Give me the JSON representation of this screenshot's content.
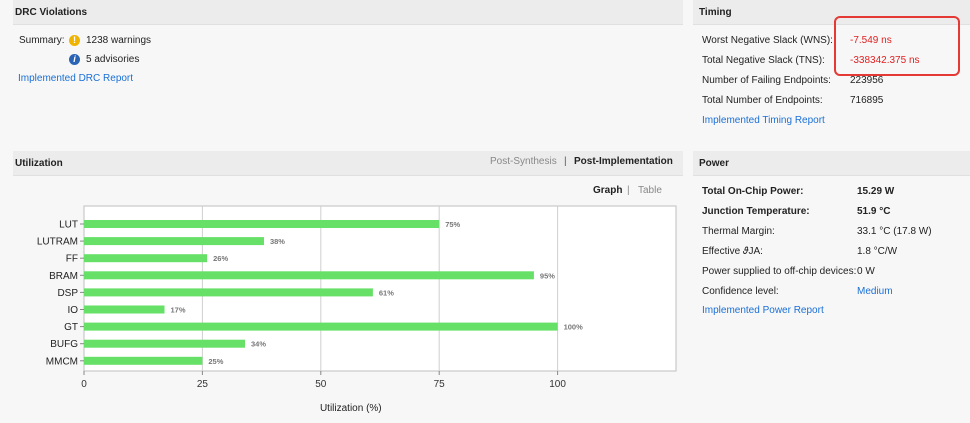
{
  "drc": {
    "title": "DRC Violations",
    "summary_label": "Summary:",
    "warnings_text": "1238 warnings",
    "advisories_text": "5 advisories",
    "report_link": "Implemented DRC Report"
  },
  "timing": {
    "title": "Timing",
    "rows": [
      {
        "label": "Worst Negative Slack (WNS):",
        "value": "-7.549 ns"
      },
      {
        "label": "Total Negative Slack (TNS):",
        "value": "-338342.375 ns"
      },
      {
        "label": "Number of Failing Endpoints:",
        "value": "223956"
      },
      {
        "label": "Total Number of Endpoints:",
        "value": "716895"
      }
    ],
    "report_link": "Implemented Timing Report"
  },
  "utilization": {
    "title": "Utilization",
    "tab_post_synthesis": "Post-Synthesis",
    "tab_separator": "|",
    "tab_post_implementation": "Post-Implementation",
    "view_graph": "Graph",
    "view_separator": "|",
    "view_table": "Table"
  },
  "power": {
    "title": "Power",
    "rows": [
      {
        "label": "Total On-Chip Power:",
        "value": "15.29 W",
        "bold": true
      },
      {
        "label": "Junction Temperature:",
        "value": "51.9 °C",
        "bold": true
      },
      {
        "label": "Thermal Margin:",
        "value": "33.1 °C (17.8 W)",
        "bold": false
      },
      {
        "label": "Effective 𝜗JA:",
        "value": "1.8 °C/W",
        "bold": false
      },
      {
        "label": "Power supplied to off-chip devices:",
        "value": "0 W",
        "bold": false
      },
      {
        "label": "Confidence level:",
        "value": "Medium",
        "bold": false,
        "link": true
      }
    ],
    "report_link": "Implemented Power Report"
  },
  "colors": {
    "bar": "#66e066",
    "link": "#1a6fd6",
    "critical": "#e02020",
    "highlight_border": "#e53935"
  },
  "chart_data": {
    "type": "bar",
    "orientation": "horizontal",
    "categories": [
      "LUT",
      "LUTRAM",
      "FF",
      "BRAM",
      "DSP",
      "IO",
      "GT",
      "BUFG",
      "MMCM"
    ],
    "values": [
      75,
      38,
      26,
      95,
      61,
      17,
      100,
      34,
      25
    ],
    "data_labels": [
      "75%",
      "38%",
      "26%",
      "95%",
      "61%",
      "17%",
      "100%",
      "34%",
      "25%"
    ],
    "xlabel": "Utilization (%)",
    "xlim": [
      0,
      125
    ],
    "xticks": [
      0,
      25,
      50,
      75,
      100
    ],
    "grid": true
  }
}
